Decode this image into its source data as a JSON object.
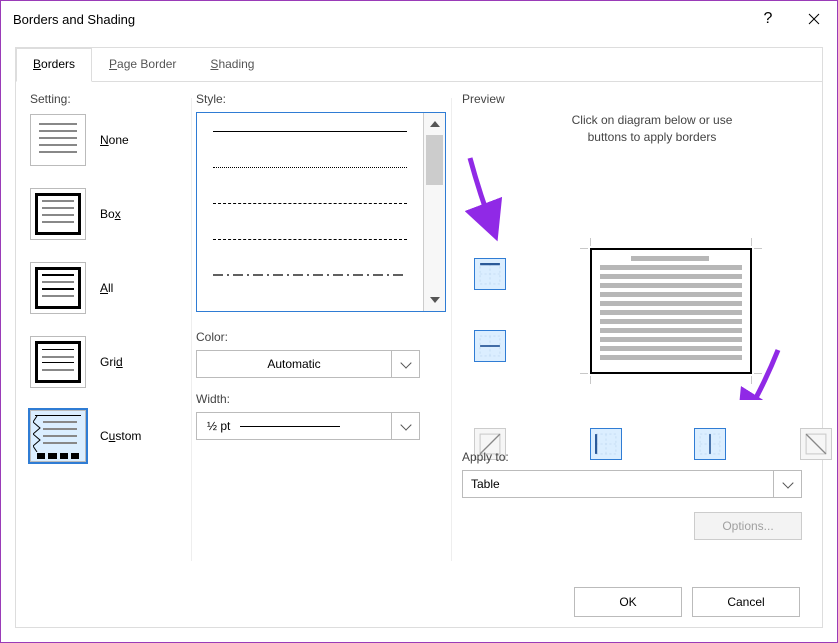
{
  "titlebar": {
    "title": "Borders and Shading"
  },
  "tabs": {
    "borders": "Borders",
    "page_border": "Page Border",
    "shading": "Shading"
  },
  "setting": {
    "label": "Setting:",
    "none": "None",
    "box": "Box",
    "all": "All",
    "grid": "Grid",
    "custom": "Custom"
  },
  "style": {
    "label": "Style:"
  },
  "color": {
    "label": "Color:",
    "value": "Automatic"
  },
  "width": {
    "label": "Width:",
    "value": "½ pt"
  },
  "preview": {
    "label": "Preview",
    "message_l1": "Click on diagram below or use",
    "message_l2": "buttons to apply borders"
  },
  "applyto": {
    "label": "Apply to:",
    "value": "Table"
  },
  "buttons": {
    "options": "Options...",
    "ok": "OK",
    "cancel": "Cancel"
  }
}
